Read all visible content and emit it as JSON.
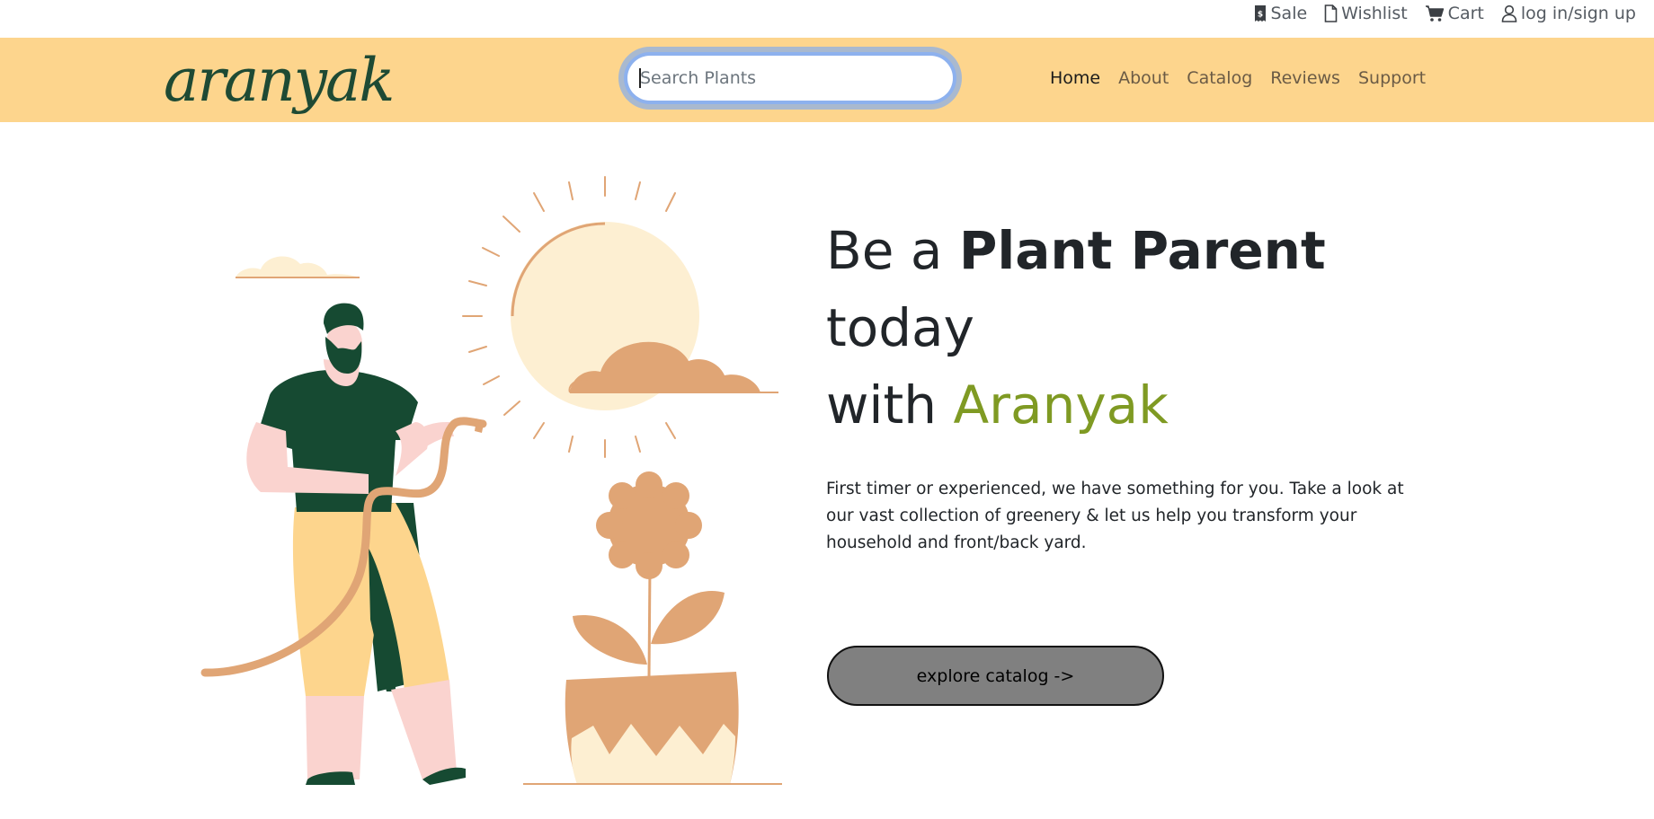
{
  "top_links": {
    "sale": "Sale",
    "wishlist": "Wishlist",
    "cart": "Cart",
    "login": "log in/sign up"
  },
  "header": {
    "logo_text": "aranyak",
    "search_placeholder": "Search Plants",
    "nav": {
      "home": "Home",
      "about": "About",
      "catalog": "Catalog",
      "reviews": "Reviews",
      "support": "Support"
    }
  },
  "hero": {
    "title_prefix": "Be a ",
    "title_bold": "Plant Parent",
    "title_line2": "today",
    "title_with": "with ",
    "title_brand": "Aranyak",
    "description": "First timer or experienced, we have something for you. Take a look at our vast collection of greenery & let us help you transform your household and front/back yard.",
    "cta_label": "explore catalog ->"
  },
  "colors": {
    "header_bg": "#fdd58d",
    "brand_green": "#7f9a23",
    "logo_green": "#1e4a34",
    "cta_bg": "#808080",
    "illustration_tan": "#e0a575",
    "illustration_cream": "#fdefd2",
    "illustration_darkgreen": "#164a32"
  },
  "icons": {
    "sale": "receipt-dollar-icon",
    "wishlist": "document-icon",
    "cart": "cart-icon",
    "login": "person-icon"
  }
}
